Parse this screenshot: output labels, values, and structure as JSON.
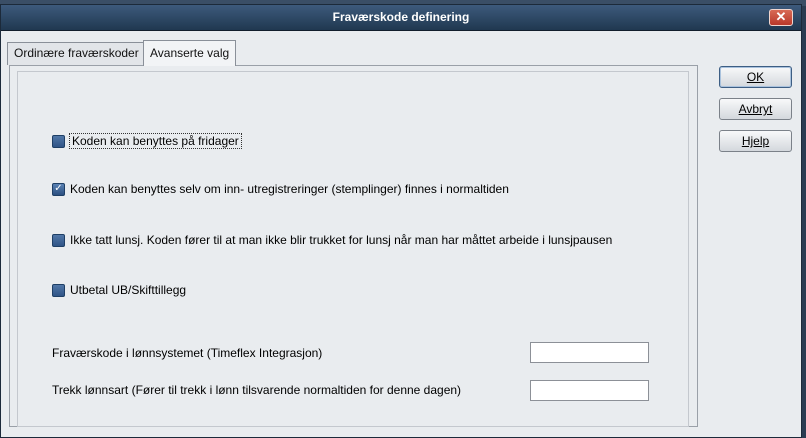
{
  "window": {
    "title": "Fraværskode definering",
    "close_symbol": "✕"
  },
  "tabs": [
    {
      "label": "Ordinære fraværskoder",
      "active": false
    },
    {
      "label": "Avanserte valg",
      "active": true
    }
  ],
  "options": [
    {
      "label": "Koden kan benyttes på fridager",
      "checked": false
    },
    {
      "label": "Koden kan benyttes selv om inn- utregistreringer (stemplinger) finnes i normaltiden",
      "checked": true
    },
    {
      "label": "Ikke tatt lunsj. Koden fører til at man ikke blir trukket for lunsj når man har måttet arbeide i lunsjpausen",
      "checked": false
    },
    {
      "label": "Utbetal UB/Skifttillegg",
      "checked": false
    }
  ],
  "fields": [
    {
      "label": "Fraværskode i lønnsystemet (Timeflex Integrasjon)",
      "value": ""
    },
    {
      "label": "Trekk lønnsart (Fører til trekk i lønn tilsvarende normaltiden for denne dagen)",
      "value": ""
    }
  ],
  "buttons": {
    "ok": "OK",
    "cancel": "Avbryt",
    "help": "Hjelp"
  },
  "colors": {
    "titlebar": "#203850",
    "checkbox": "#2f5486",
    "window_bg": "#e9ecef"
  }
}
